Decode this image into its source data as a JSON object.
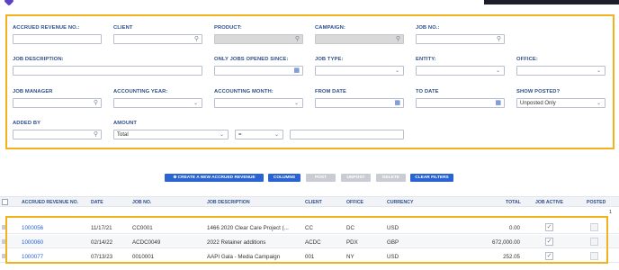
{
  "filters": {
    "accrued_revenue_no": {
      "label": "ACCRUED REVENUE NO.:",
      "value": ""
    },
    "client": {
      "label": "CLIENT",
      "value": "",
      "icon": "search-icon"
    },
    "product": {
      "label": "PRODUCT:",
      "value": "",
      "icon": "search-icon"
    },
    "campaign": {
      "label": "CAMPAIGN:",
      "value": "",
      "icon": "search-icon"
    },
    "job_no": {
      "label": "JOB NO.:",
      "value": "",
      "icon": "search-icon"
    },
    "job_description": {
      "label": "JOB DESCRIPTION:",
      "value": ""
    },
    "only_jobs_opened_since": {
      "label": "ONLY JOBS OPENED SINCE:",
      "value": "",
      "icon": "calendar-icon"
    },
    "job_type": {
      "label": "JOB TYPE:",
      "value": ""
    },
    "entity": {
      "label": "ENTITY:",
      "value": ""
    },
    "office": {
      "label": "OFFICE:",
      "value": ""
    },
    "job_manager": {
      "label": "JOB MANAGER",
      "value": ""
    },
    "accounting_year": {
      "label": "ACCOUNTING YEAR:",
      "value": ""
    },
    "accounting_month": {
      "label": "ACCOUNTING MONTH:",
      "value": ""
    },
    "from_date": {
      "label": "FROM DATE",
      "value": ""
    },
    "to_date": {
      "label": "TO DATE",
      "value": ""
    },
    "show_posted": {
      "label": "SHOW POSTED?",
      "value": "Unposted Only"
    },
    "added_by": {
      "label": "ADDED BY",
      "value": ""
    },
    "amount": {
      "label": "AMOUNT",
      "value": "Total",
      "operator": "=",
      "amount_value": ""
    }
  },
  "toolbar": {
    "create_label": "CREATE A NEW ACCRUED REVENUE",
    "columns_label": "COLUMNS",
    "post_label": "POST",
    "unpost_label": "UNPOST",
    "delete_label": "DELETE",
    "clear_filters_label": "CLEAR FILTERS"
  },
  "table": {
    "columns": [
      "ACCRUED REVENUE NO.",
      "DATE",
      "JOB NO.",
      "JOB DESCRIPTION",
      "CLIENT",
      "OFFICE",
      "CURRENCY",
      "TOTAL",
      "JOB ACTIVE",
      "POSTED"
    ],
    "page": "1",
    "rows": [
      {
        "no": "1000056",
        "date": "11/17/21",
        "job_no": "CC0001",
        "description": "1466 2020 Clear Care Project (...",
        "client": "CC",
        "office": "DC",
        "currency": "USD",
        "total": "0.00",
        "job_active": true,
        "posted": false
      },
      {
        "no": "1000060",
        "date": "02/14/22",
        "job_no": "ACDC0049",
        "description": "2022 Retainer additions",
        "client": "ACDC",
        "office": "PDX",
        "currency": "GBP",
        "total": "672,000.00",
        "job_active": true,
        "posted": false
      },
      {
        "no": "1000077",
        "date": "07/13/23",
        "job_no": "0010001",
        "description": "AAPI Gala - Media Campaign",
        "client": "001",
        "office": "NY",
        "currency": "USD",
        "total": "252.05",
        "job_active": true,
        "posted": false
      }
    ]
  },
  "colors": {
    "accent": "#2a63d2",
    "highlight": "#f2b21b",
    "disabled_button": "#c9cdd3"
  }
}
